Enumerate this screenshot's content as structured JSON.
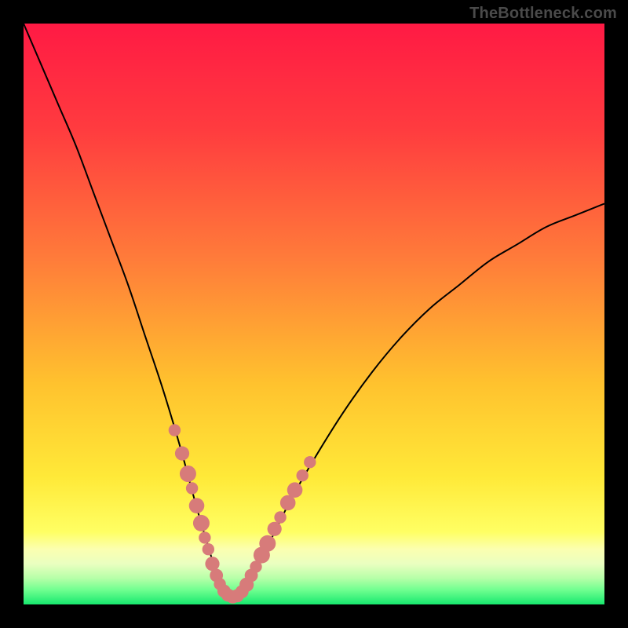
{
  "watermark": {
    "text": "TheBottleneck.com"
  },
  "colors": {
    "frame": "#000000",
    "curve_stroke": "#000000",
    "marker_fill": "#d77b7a",
    "gradient_stops": [
      {
        "offset": 0.0,
        "color": "#ff1a44"
      },
      {
        "offset": 0.18,
        "color": "#ff3b3f"
      },
      {
        "offset": 0.4,
        "color": "#ff7a3a"
      },
      {
        "offset": 0.62,
        "color": "#ffc22e"
      },
      {
        "offset": 0.78,
        "color": "#ffe938"
      },
      {
        "offset": 0.875,
        "color": "#ffff63"
      },
      {
        "offset": 0.905,
        "color": "#fbffb0"
      },
      {
        "offset": 0.93,
        "color": "#eaffc0"
      },
      {
        "offset": 0.955,
        "color": "#b6ffa8"
      },
      {
        "offset": 0.975,
        "color": "#70ff90"
      },
      {
        "offset": 1.0,
        "color": "#17e86e"
      }
    ]
  },
  "chart_data": {
    "type": "line",
    "title": "",
    "xlabel": "",
    "ylabel": "",
    "xlim": [
      0,
      100
    ],
    "ylim": [
      0,
      100
    ],
    "grid": false,
    "note": "Values are read from pixel geometry; y=100 is top (worst/red), y=0 is bottom (best/green). Minimum near x≈35.",
    "series": [
      {
        "name": "bottleneck-curve",
        "x": [
          0,
          3,
          6,
          9,
          12,
          15,
          18,
          21,
          24,
          27,
          30,
          33,
          34,
          35,
          36,
          37,
          40,
          43,
          46,
          50,
          55,
          60,
          65,
          70,
          75,
          80,
          85,
          90,
          95,
          100
        ],
        "y": [
          100,
          93,
          86,
          79,
          71,
          63,
          55,
          46,
          37,
          27,
          16,
          6,
          3,
          1,
          1,
          2,
          6,
          12,
          18,
          25,
          33,
          40,
          46,
          51,
          55,
          59,
          62,
          65,
          67,
          69
        ]
      }
    ],
    "markers": {
      "name": "highlighted-points",
      "shape": "circle",
      "points": [
        {
          "x": 26.0,
          "y": 30.0,
          "r": 1.1
        },
        {
          "x": 27.3,
          "y": 26.0,
          "r": 1.3
        },
        {
          "x": 28.3,
          "y": 22.5,
          "r": 1.5
        },
        {
          "x": 29.0,
          "y": 20.0,
          "r": 1.1
        },
        {
          "x": 29.8,
          "y": 17.0,
          "r": 1.4
        },
        {
          "x": 30.6,
          "y": 14.0,
          "r": 1.5
        },
        {
          "x": 31.2,
          "y": 11.5,
          "r": 1.1
        },
        {
          "x": 31.8,
          "y": 9.5,
          "r": 1.1
        },
        {
          "x": 32.5,
          "y": 7.0,
          "r": 1.3
        },
        {
          "x": 33.2,
          "y": 5.0,
          "r": 1.2
        },
        {
          "x": 33.8,
          "y": 3.5,
          "r": 1.1
        },
        {
          "x": 34.5,
          "y": 2.3,
          "r": 1.2
        },
        {
          "x": 35.2,
          "y": 1.6,
          "r": 1.2
        },
        {
          "x": 36.0,
          "y": 1.3,
          "r": 1.2
        },
        {
          "x": 36.8,
          "y": 1.5,
          "r": 1.2
        },
        {
          "x": 37.6,
          "y": 2.2,
          "r": 1.2
        },
        {
          "x": 38.4,
          "y": 3.4,
          "r": 1.3
        },
        {
          "x": 39.2,
          "y": 5.0,
          "r": 1.2
        },
        {
          "x": 40.0,
          "y": 6.5,
          "r": 1.1
        },
        {
          "x": 41.0,
          "y": 8.5,
          "r": 1.5
        },
        {
          "x": 42.0,
          "y": 10.5,
          "r": 1.5
        },
        {
          "x": 43.2,
          "y": 13.0,
          "r": 1.3
        },
        {
          "x": 44.2,
          "y": 15.0,
          "r": 1.1
        },
        {
          "x": 45.5,
          "y": 17.5,
          "r": 1.4
        },
        {
          "x": 46.7,
          "y": 19.7,
          "r": 1.4
        },
        {
          "x": 48.0,
          "y": 22.2,
          "r": 1.1
        },
        {
          "x": 49.3,
          "y": 24.5,
          "r": 1.1
        }
      ]
    }
  }
}
